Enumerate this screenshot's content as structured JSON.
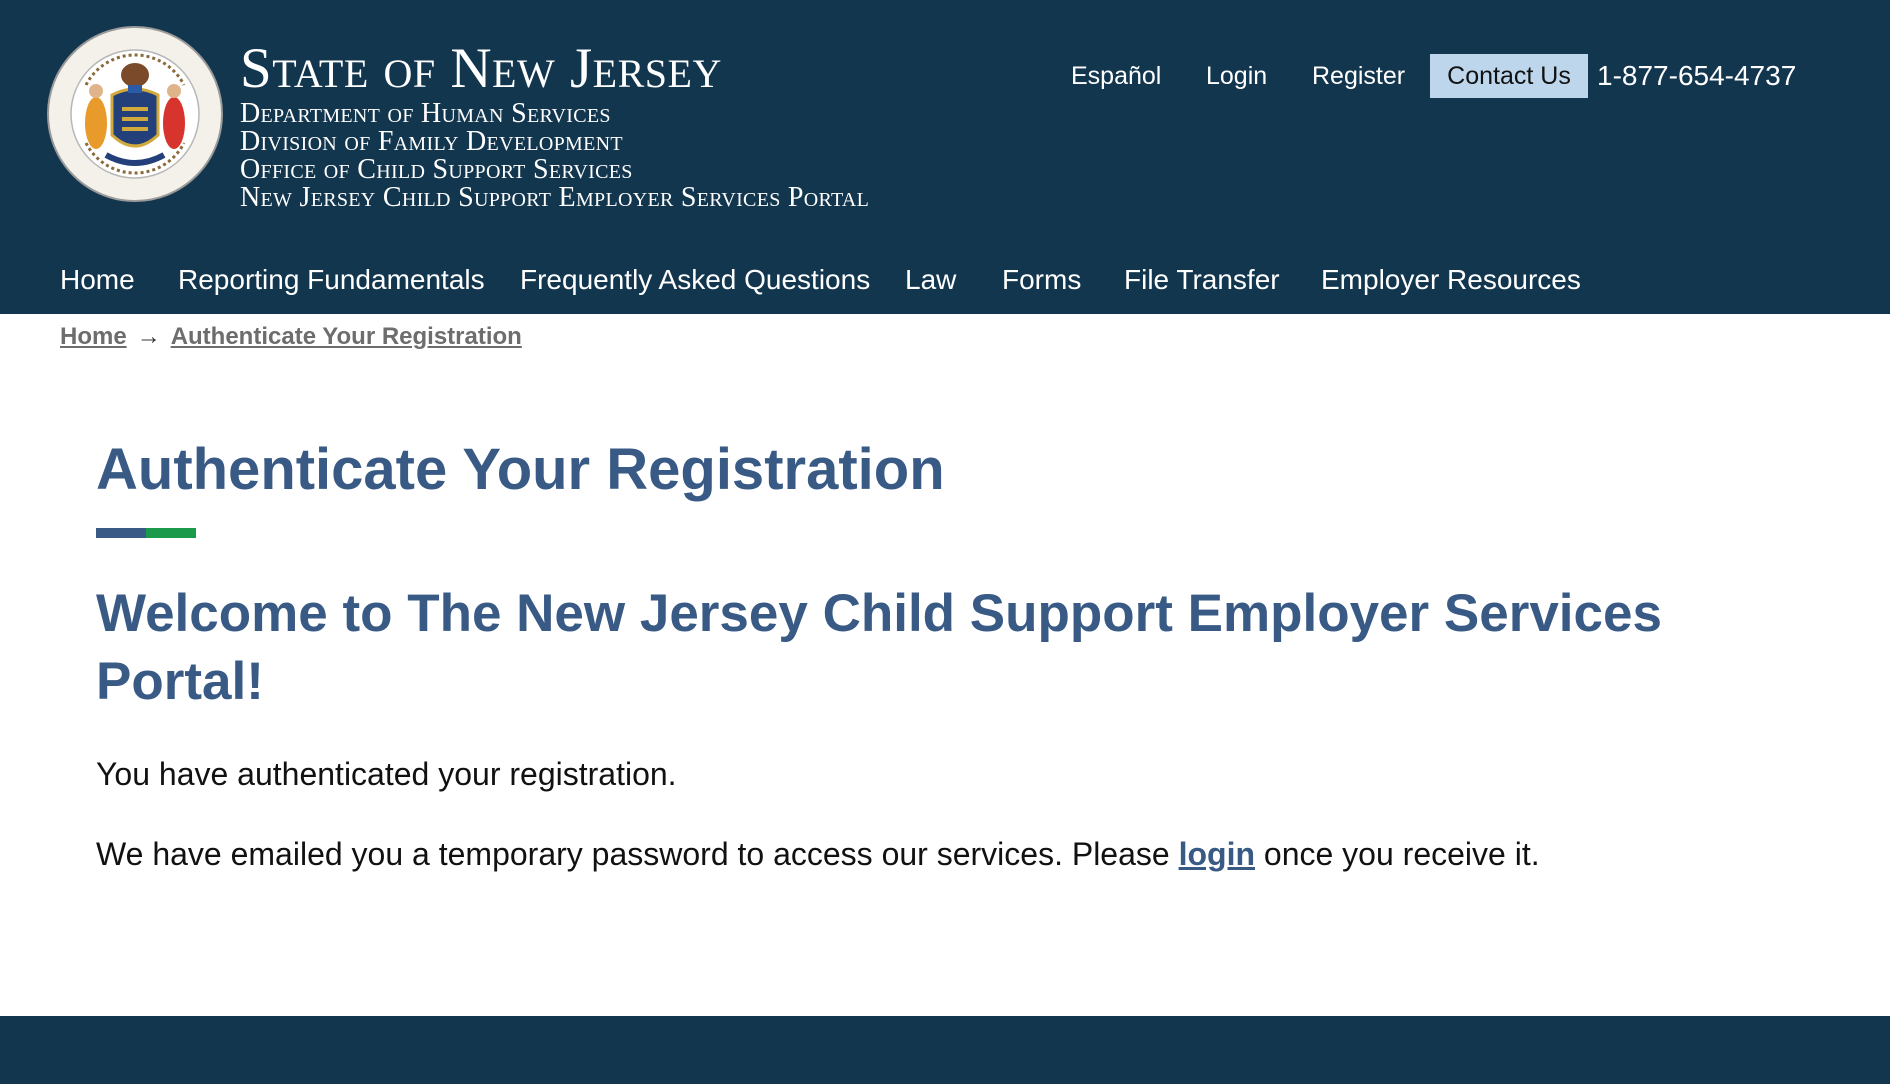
{
  "colors": {
    "header_bg": "#13364f",
    "accent_blue": "#385a84",
    "accent_green": "#1a9a4a",
    "contact_bg": "#bdd6ec"
  },
  "brand": {
    "title": "State of New Jersey",
    "lines": [
      "Department of Human Services",
      "Division of Family Development",
      "Office of Child Support Services",
      "New Jersey Child Support Employer Services Portal"
    ],
    "seal_icon": "nj-state-seal-icon"
  },
  "utility": {
    "espanol": "Español",
    "login": "Login",
    "register": "Register",
    "contact": "Contact Us",
    "phone": "1-877-654-4737"
  },
  "nav": [
    {
      "label": "Home"
    },
    {
      "label": "Reporting Fundamentals"
    },
    {
      "label": "Frequently Asked Questions"
    },
    {
      "label": "Law"
    },
    {
      "label": "Forms"
    },
    {
      "label": "File Transfer"
    },
    {
      "label": "Employer Resources"
    }
  ],
  "breadcrumb": {
    "home": "Home",
    "separator": "→",
    "current": "Authenticate Your Registration"
  },
  "main": {
    "title": "Authenticate Your Registration",
    "welcome": "Welcome to The New Jersey Child Support Employer Services Portal!",
    "para1": "You have authenticated your registration.",
    "para2_before": "We have emailed you a temporary password to access our services. Please ",
    "para2_link": "login",
    "para2_after": " once you receive it."
  }
}
